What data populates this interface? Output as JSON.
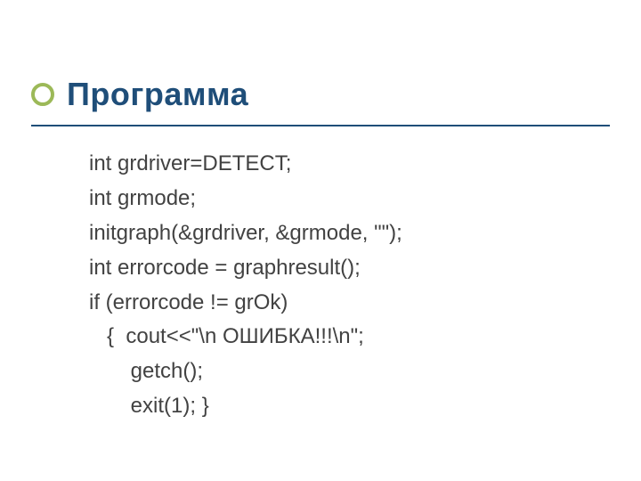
{
  "title": "Программа",
  "code": {
    "l1": "int grdriver=DETECT;",
    "l2": "int grmode;",
    "l3": "initgraph(&grdriver, &grmode, \"\");",
    "l4": "int errorcode = graphresult();",
    "l5": "if (errorcode != grOk)",
    "l6": "   {  cout<<\"\\n ОШИБКА!!!\\n\";",
    "l7": "       getch();",
    "l8": "       exit(1); }"
  }
}
